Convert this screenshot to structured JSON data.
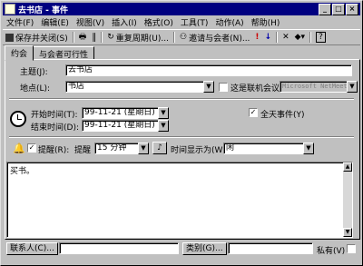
{
  "window": {
    "title": "去书店 - 事件"
  },
  "titlebar_buttons": [
    "_",
    "□",
    "×"
  ],
  "menu": [
    "文件(F)",
    "编辑(E)",
    "视图(V)",
    "插入(I)",
    "格式(O)",
    "工具(T)",
    "动作(A)",
    "帮助(H)"
  ],
  "toolbar": {
    "save_close": "保存并关闭(S)",
    "recurrence": "重复周期(U)...",
    "invite": "邀请与会者(N)...",
    "help": "?"
  },
  "tabs": [
    "约会",
    "与会者可行性"
  ],
  "form": {
    "subject_label": "主题(J):",
    "subject_value": "去书店",
    "location_label": "地点(L):",
    "location_value": "书店",
    "online_label": "这是联机会议:",
    "online_value": "Microsoft NetMeet",
    "start_label": "开始时间(T):",
    "start_value": "99-11-21 (星期日)",
    "end_label": "结束时间(D):",
    "end_value": "99-11-21 (星期日)",
    "allday_label": "全天事件(Y)",
    "allday_checked": "✓",
    "reminder_label": "提醒(R):",
    "reminder_checked": "✓",
    "reminder_prefix": "提醒",
    "reminder_value": "15 分钟",
    "showas_label": "时间显示为(W):",
    "showas_value": "闲",
    "notes": "买书。"
  },
  "footer": {
    "contacts_button": "联系人(C)...",
    "categories_button": "类别(G)...",
    "private_label": "私有(V)"
  }
}
